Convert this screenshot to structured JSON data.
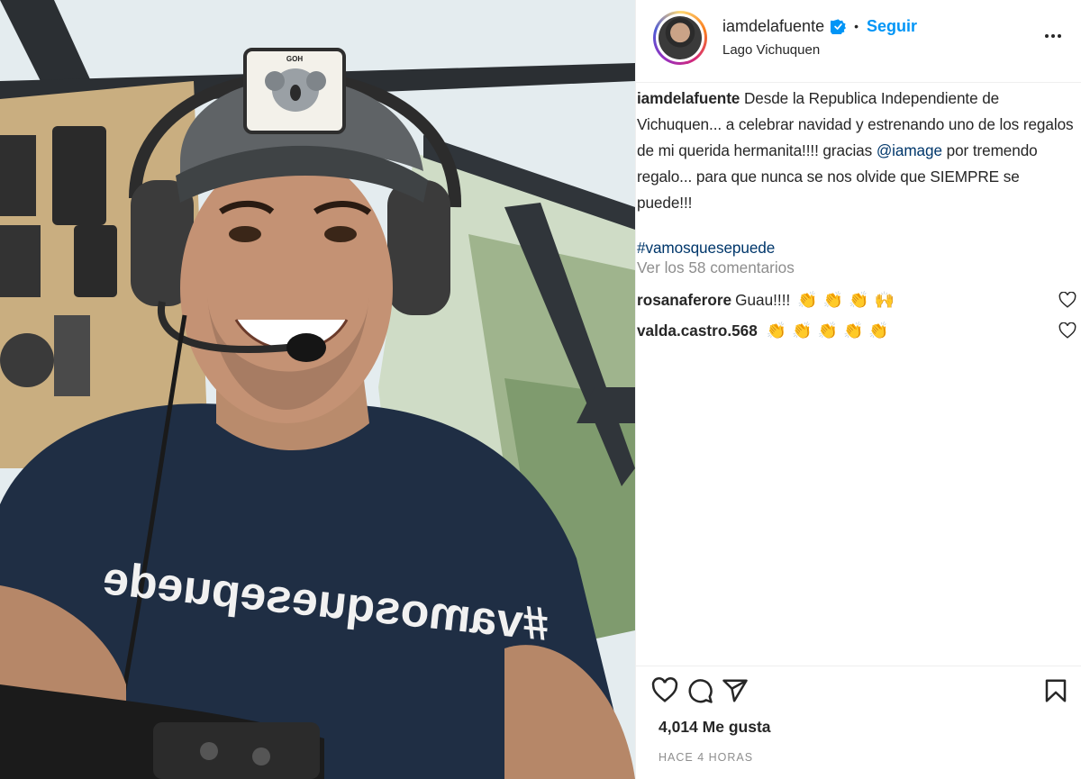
{
  "post": {
    "username": "iamdelafuente",
    "follow_label": "Seguir",
    "separator": "•",
    "location": "Lago Vichuquen",
    "shirt_text": "#vamosquesepuede",
    "cap_patch": "GOH"
  },
  "caption": {
    "username": "iamdelafuente",
    "text_1": " Desde la Republica Independiente de Vichuquen... a celebrar navidad y estrenando uno de los regalos de mi querida hermanita!!!! gracias ",
    "mention": "@iamage",
    "text_2": " por tremendo regalo... para que nunca se nos olvide que SIEMPRE se puede!!!",
    "hashtag": "#vamosquesepuede"
  },
  "view_comments": "Ver los 58 comentarios",
  "comments": [
    {
      "user": "rosanaferore",
      "text": "Guau!!!!",
      "emoji": "👏👏👏🙌"
    },
    {
      "user": "valda.castro.568",
      "text": "",
      "emoji": "👏👏👏👏👏"
    }
  ],
  "likes": "4,014 Me gusta",
  "timestamp": "HACE 4 HORAS",
  "colors": {
    "follow_blue": "#0095f6",
    "verified_blue": "#0095f6",
    "link_blue": "#00376b",
    "muted": "#8e8e8e"
  },
  "icons": [
    "verified-icon",
    "more-options-icon",
    "heart-icon",
    "comment-icon",
    "share-icon",
    "bookmark-icon"
  ]
}
